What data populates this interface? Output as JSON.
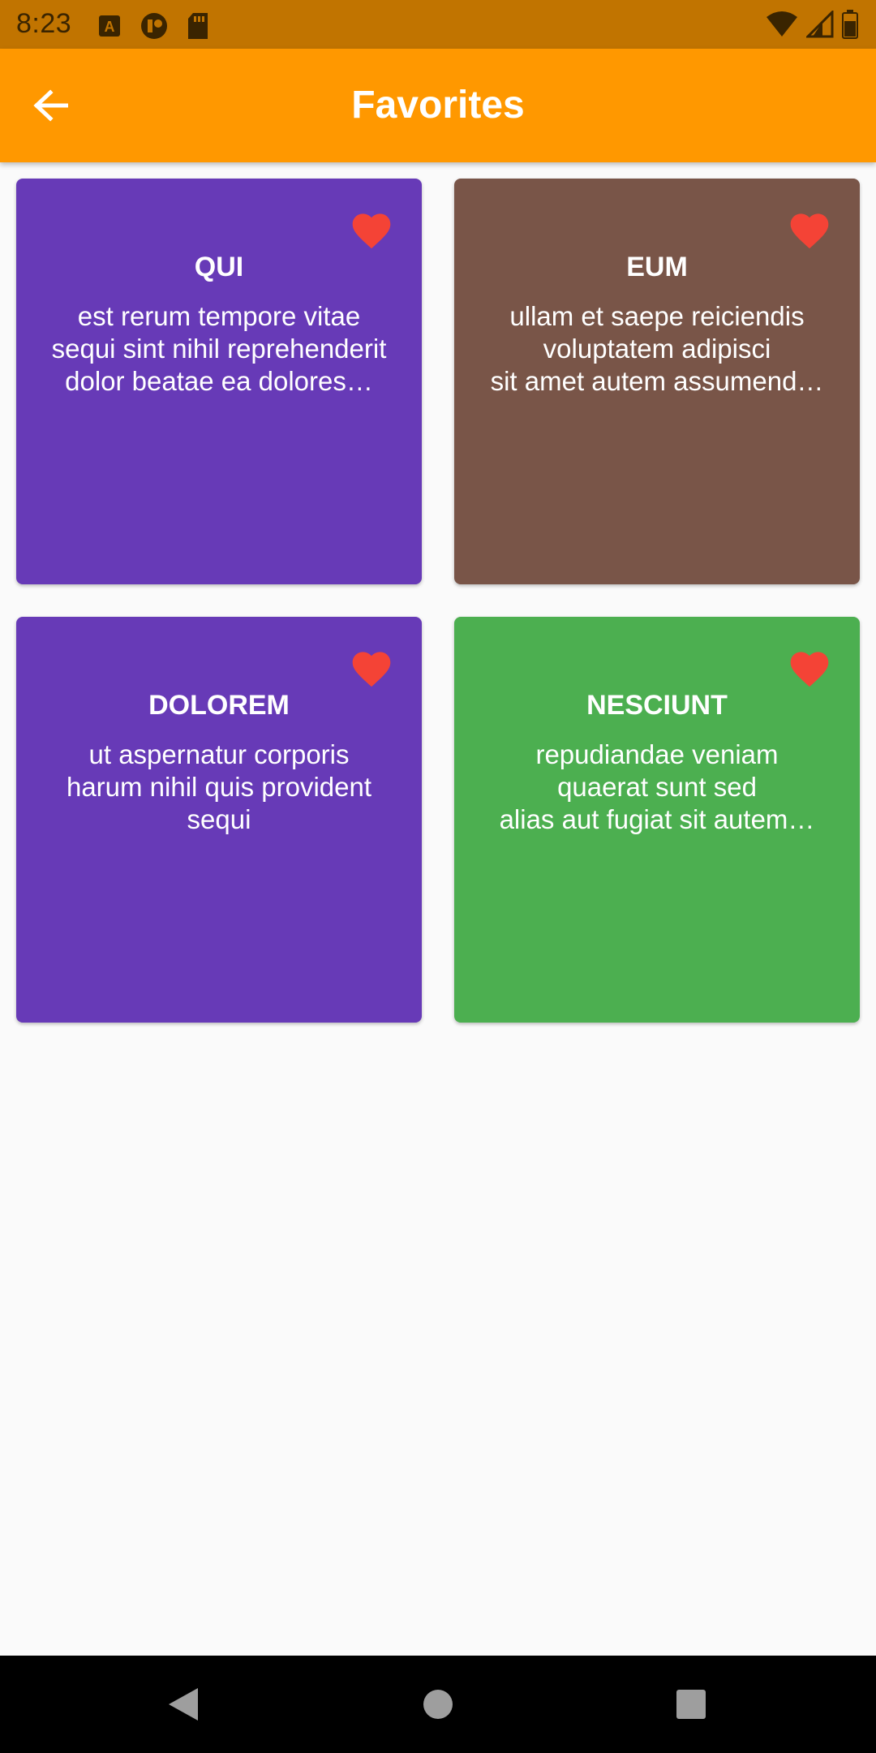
{
  "status_bar": {
    "time": "8:23",
    "icons_left": [
      "a-badge-icon",
      "record-icon",
      "sd-card-icon"
    ],
    "icons_right": [
      "wifi-icon",
      "signal-icon",
      "battery-icon"
    ]
  },
  "app_bar": {
    "title": "Favorites",
    "back_icon": "arrow-back-icon",
    "background": "#ff9800",
    "status_background": "#c17400"
  },
  "cards": [
    {
      "title": "QUI",
      "body": "est rerum tempore vitae\nsequi sint nihil reprehenderit\ndolor beatae ea dolores…",
      "color": "#673ab7",
      "favorite": true
    },
    {
      "title": "EUM",
      "body": "ullam et saepe reiciendis\nvoluptatem adipisci\nsit amet autem assumend…",
      "color": "#795548",
      "favorite": true
    },
    {
      "title": "DOLOREM",
      "body": "ut aspernatur corporis\nharum nihil quis provident\nsequi",
      "color": "#673ab7",
      "favorite": true
    },
    {
      "title": "NESCIUNT",
      "body": "repudiandae veniam\nquaerat sunt sed\nalias aut fugiat sit autem…",
      "color": "#4caf50",
      "favorite": true
    }
  ],
  "favorite_color": "#f44336",
  "nav_bar": {
    "icons": [
      "nav-back-icon",
      "nav-home-icon",
      "nav-recents-icon"
    ]
  }
}
